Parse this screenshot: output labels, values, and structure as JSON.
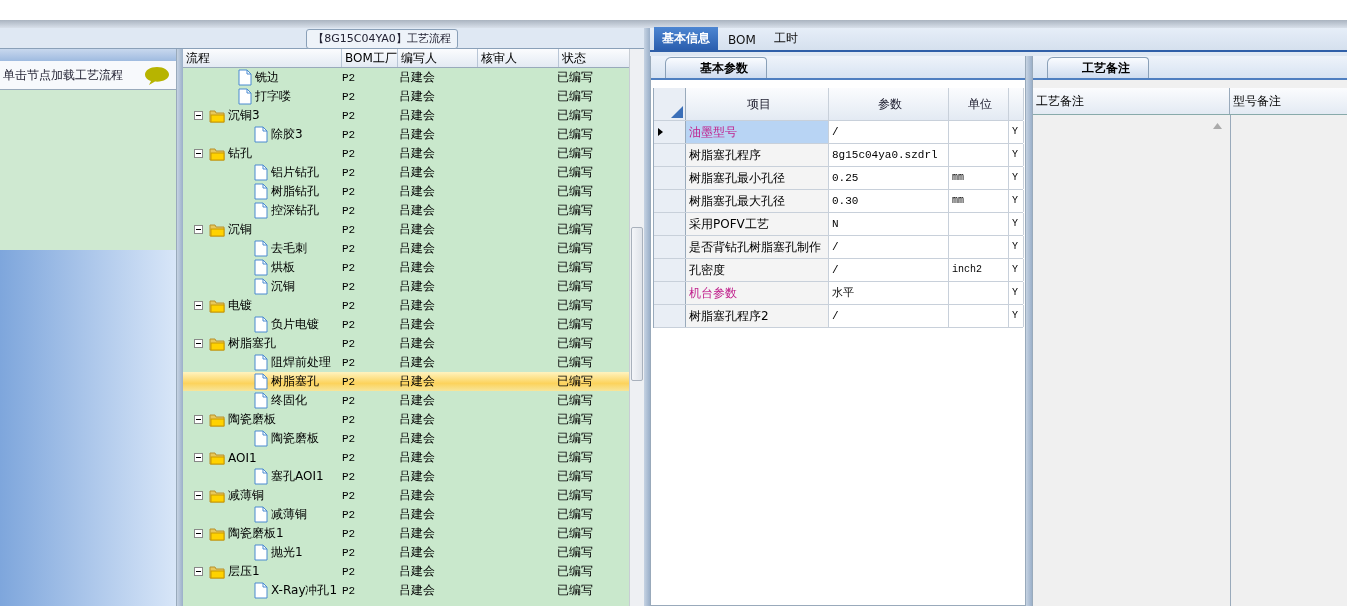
{
  "flow_title": "【8G15C04YA0】工艺流程",
  "left_panel": {
    "hint": "单击节点加载工艺流程"
  },
  "process_tree": {
    "columns": [
      "流程",
      "BOM工厂",
      "编写人",
      "核审人",
      "状态"
    ],
    "items": [
      {
        "kind": "file",
        "label": "铣边",
        "factory": "P2",
        "writer": "吕建会",
        "status": "已编写",
        "selected": false
      },
      {
        "kind": "file",
        "label": "打字喽",
        "factory": "P2",
        "writer": "吕建会",
        "status": "已编写",
        "selected": false
      },
      {
        "kind": "folder",
        "label": "沉铜3",
        "factory": "P2",
        "writer": "吕建会",
        "status": "已编写",
        "selected": false,
        "expanded": true,
        "children": [
          {
            "kind": "file",
            "label": "除胶3",
            "factory": "P2",
            "writer": "吕建会",
            "status": "已编写",
            "selected": false
          }
        ]
      },
      {
        "kind": "folder",
        "label": "钻孔",
        "factory": "P2",
        "writer": "吕建会",
        "status": "已编写",
        "selected": false,
        "expanded": true,
        "children": [
          {
            "kind": "file",
            "label": "铝片钻孔",
            "factory": "P2",
            "writer": "吕建会",
            "status": "已编写",
            "selected": false
          },
          {
            "kind": "file",
            "label": "树脂钻孔",
            "factory": "P2",
            "writer": "吕建会",
            "status": "已编写",
            "selected": false
          },
          {
            "kind": "file",
            "label": "控深钻孔",
            "factory": "P2",
            "writer": "吕建会",
            "status": "已编写",
            "selected": false
          }
        ]
      },
      {
        "kind": "folder",
        "label": "沉铜",
        "factory": "P2",
        "writer": "吕建会",
        "status": "已编写",
        "selected": false,
        "expanded": true,
        "children": [
          {
            "kind": "file",
            "label": "去毛刺",
            "factory": "P2",
            "writer": "吕建会",
            "status": "已编写",
            "selected": false
          },
          {
            "kind": "file",
            "label": "烘板",
            "factory": "P2",
            "writer": "吕建会",
            "status": "已编写",
            "selected": false
          },
          {
            "kind": "file",
            "label": "沉铜",
            "factory": "P2",
            "writer": "吕建会",
            "status": "已编写",
            "selected": false
          }
        ]
      },
      {
        "kind": "folder",
        "label": "电镀",
        "factory": "P2",
        "writer": "吕建会",
        "status": "已编写",
        "selected": false,
        "expanded": true,
        "children": [
          {
            "kind": "file",
            "label": "负片电镀",
            "factory": "P2",
            "writer": "吕建会",
            "status": "已编写",
            "selected": false
          }
        ]
      },
      {
        "kind": "folder",
        "label": "树脂塞孔",
        "factory": "P2",
        "writer": "吕建会",
        "status": "已编写",
        "selected": false,
        "expanded": true,
        "children": [
          {
            "kind": "file",
            "label": "阻焊前处理",
            "factory": "P2",
            "writer": "吕建会",
            "status": "已编写",
            "selected": false
          },
          {
            "kind": "file",
            "label": "树脂塞孔",
            "factory": "P2",
            "writer": "吕建会",
            "status": "已编写",
            "selected": true
          },
          {
            "kind": "file",
            "label": "终固化",
            "factory": "P2",
            "writer": "吕建会",
            "status": "已编写",
            "selected": false
          }
        ]
      },
      {
        "kind": "folder",
        "label": "陶瓷磨板",
        "factory": "P2",
        "writer": "吕建会",
        "status": "已编写",
        "selected": false,
        "expanded": true,
        "children": [
          {
            "kind": "file",
            "label": "陶瓷磨板",
            "factory": "P2",
            "writer": "吕建会",
            "status": "已编写",
            "selected": false
          }
        ]
      },
      {
        "kind": "folder",
        "label": "AOI1",
        "factory": "P2",
        "writer": "吕建会",
        "status": "已编写",
        "selected": false,
        "expanded": true,
        "children": [
          {
            "kind": "file",
            "label": "塞孔AOI1",
            "factory": "P2",
            "writer": "吕建会",
            "status": "已编写",
            "selected": false
          }
        ]
      },
      {
        "kind": "folder",
        "label": "减薄铜",
        "factory": "P2",
        "writer": "吕建会",
        "status": "已编写",
        "selected": false,
        "expanded": true,
        "children": [
          {
            "kind": "file",
            "label": "减薄铜",
            "factory": "P2",
            "writer": "吕建会",
            "status": "已编写",
            "selected": false
          }
        ]
      },
      {
        "kind": "folder",
        "label": "陶瓷磨板1",
        "factory": "P2",
        "writer": "吕建会",
        "status": "已编写",
        "selected": false,
        "expanded": true,
        "children": [
          {
            "kind": "file",
            "label": "抛光1",
            "factory": "P2",
            "writer": "吕建会",
            "status": "已编写",
            "selected": false
          }
        ]
      },
      {
        "kind": "folder",
        "label": "层压1",
        "factory": "P2",
        "writer": "吕建会",
        "status": "已编写",
        "selected": false,
        "expanded": true,
        "children": [
          {
            "kind": "file",
            "label": "X-Ray冲孔1",
            "factory": "P2",
            "writer": "吕建会",
            "status": "已编写",
            "selected": false
          }
        ]
      }
    ]
  },
  "tabs": [
    {
      "label": "基本信息",
      "selected": true
    },
    {
      "label": "BOM",
      "selected": false
    },
    {
      "label": "工时",
      "selected": false
    }
  ],
  "params": {
    "tab": "基本参数",
    "columns": [
      "项目",
      "参数",
      "单位"
    ],
    "rows": [
      {
        "item": "油墨型号",
        "value": "/",
        "unit": "",
        "flag": "Y",
        "highlighted": true,
        "selected": true
      },
      {
        "item": "树脂塞孔程序",
        "value": "8g15c04ya0.szdrl",
        "unit": "",
        "flag": "Y",
        "highlighted": false,
        "selected": false
      },
      {
        "item": "树脂塞孔最小孔径",
        "value": "0.25",
        "unit": "mm",
        "flag": "Y",
        "highlighted": false,
        "selected": false
      },
      {
        "item": "树脂塞孔最大孔径",
        "value": "0.30",
        "unit": "mm",
        "flag": "Y",
        "highlighted": false,
        "selected": false
      },
      {
        "item": "采用POFV工艺",
        "value": "N",
        "unit": "",
        "flag": "Y",
        "highlighted": false,
        "selected": false
      },
      {
        "item": "是否背钻孔树脂塞孔制作",
        "value": "/",
        "unit": "",
        "flag": "Y",
        "highlighted": false,
        "selected": false
      },
      {
        "item": "孔密度",
        "value": "/",
        "unit": "inch2",
        "flag": "Y",
        "highlighted": false,
        "selected": false
      },
      {
        "item": "机台参数",
        "value": "水平",
        "unit": "",
        "flag": "Y",
        "highlighted": true,
        "selected": false
      },
      {
        "item": "树脂塞孔程序2",
        "value": "/",
        "unit": "",
        "flag": "Y",
        "highlighted": false,
        "selected": false
      }
    ]
  },
  "notes": {
    "tab": "工艺备注",
    "columns": [
      "工艺备注",
      "型号备注"
    ]
  }
}
